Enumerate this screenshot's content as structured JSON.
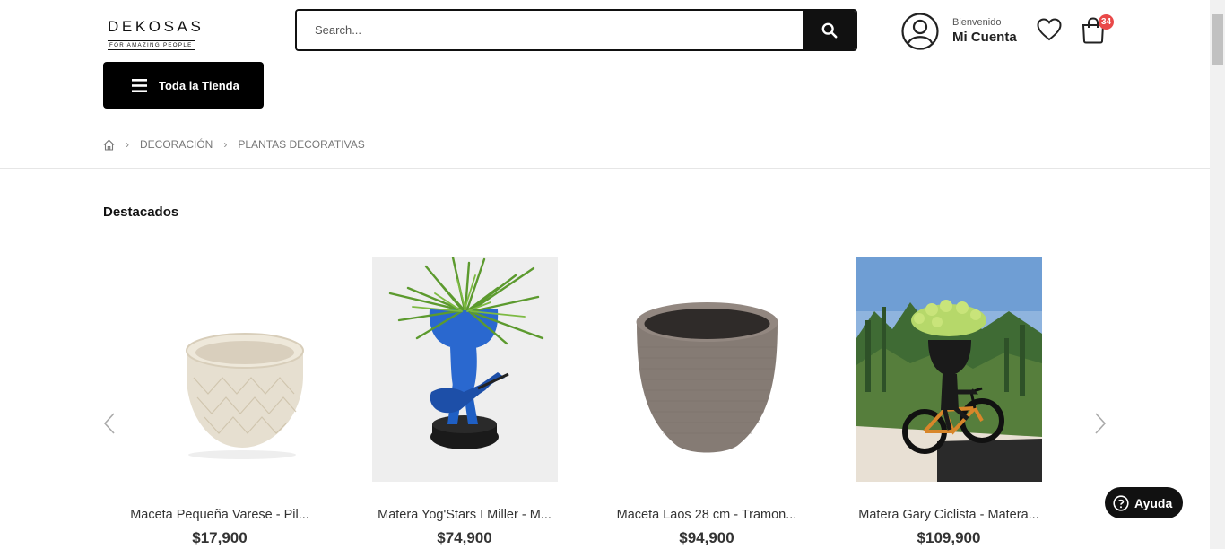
{
  "brand": {
    "logo_main": "DEKOSAS",
    "logo_sub": "FOR AMAZING PEOPLE"
  },
  "search": {
    "placeholder": "Search..."
  },
  "account": {
    "welcome": "Bienvenido",
    "name": "Mi Cuenta"
  },
  "cart": {
    "count": "34"
  },
  "store_menu": {
    "label": "Toda la Tienda"
  },
  "breadcrumb": {
    "items": [
      "DECORACIÓN",
      "PLANTAS DECORATIVAS"
    ]
  },
  "section": {
    "title": "Destacados"
  },
  "products": [
    {
      "name": "Maceta Pequeña Varese - Pil...",
      "price": "$17,900"
    },
    {
      "name": "Matera Yog'Stars I Miller - M...",
      "price": "$74,900"
    },
    {
      "name": "Maceta Laos 28 cm - Tramon...",
      "price": "$94,900"
    },
    {
      "name": "Matera Gary Ciclista - Matera...",
      "price": "$109,900"
    }
  ],
  "help": {
    "label": "Ayuda"
  },
  "colors": {
    "accent": "#000000",
    "badge": "#e94848",
    "text": "#333333"
  },
  "icons": [
    "search-icon",
    "user-icon",
    "heart-icon",
    "bag-icon",
    "menu-icon",
    "home-icon",
    "chevron-left-icon",
    "chevron-right-icon",
    "help-icon"
  ]
}
